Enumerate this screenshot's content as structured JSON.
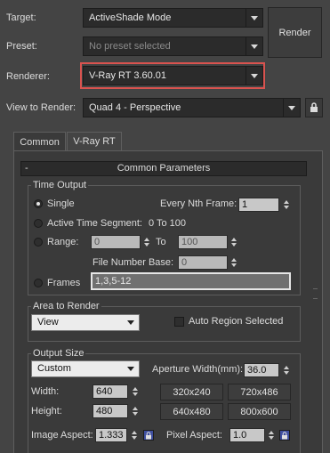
{
  "top": {
    "target_label": "Target:",
    "target_value": "ActiveShade Mode",
    "preset_label": "Preset:",
    "preset_value": "No preset selected",
    "renderer_label": "Renderer:",
    "renderer_value": "V-Ray RT 3.60.01",
    "view_label": "View to Render:",
    "view_value": "Quad 4 - Perspective",
    "render_button": "Render"
  },
  "tabs": [
    {
      "label": "Common"
    },
    {
      "label": "V-Ray RT"
    }
  ],
  "rollout": {
    "collapse": "-",
    "title": "Common Parameters"
  },
  "time_output": {
    "title": "Time Output",
    "single": "Single",
    "every_nth_label": "Every Nth Frame:",
    "every_nth_value": "1",
    "active_segment": "Active Time Segment:",
    "active_range": "0 To 100",
    "range": "Range:",
    "range_from": "0",
    "range_to_label": "To",
    "range_to": "100",
    "file_base_label": "File Number Base:",
    "file_base_value": "0",
    "frames": "Frames",
    "frames_value": "1,3,5-12"
  },
  "area": {
    "title": "Area to Render",
    "value": "View",
    "auto_region": "Auto Region Selected"
  },
  "output_size": {
    "title": "Output Size",
    "preset": "Custom",
    "aperture_label": "Aperture Width(mm):",
    "aperture_value": "36.0",
    "width_label": "Width:",
    "width_value": "640",
    "height_label": "Height:",
    "height_value": "480",
    "presets": [
      "320x240",
      "720x486",
      "640x480",
      "800x600"
    ],
    "image_aspect_label": "Image Aspect:",
    "image_aspect_value": "1.333",
    "pixel_aspect_label": "Pixel Aspect:",
    "pixel_aspect_value": "1.0"
  },
  "colors": {
    "highlight": "#d9534f",
    "panel": "#3a3a3a",
    "background": "#444444"
  }
}
